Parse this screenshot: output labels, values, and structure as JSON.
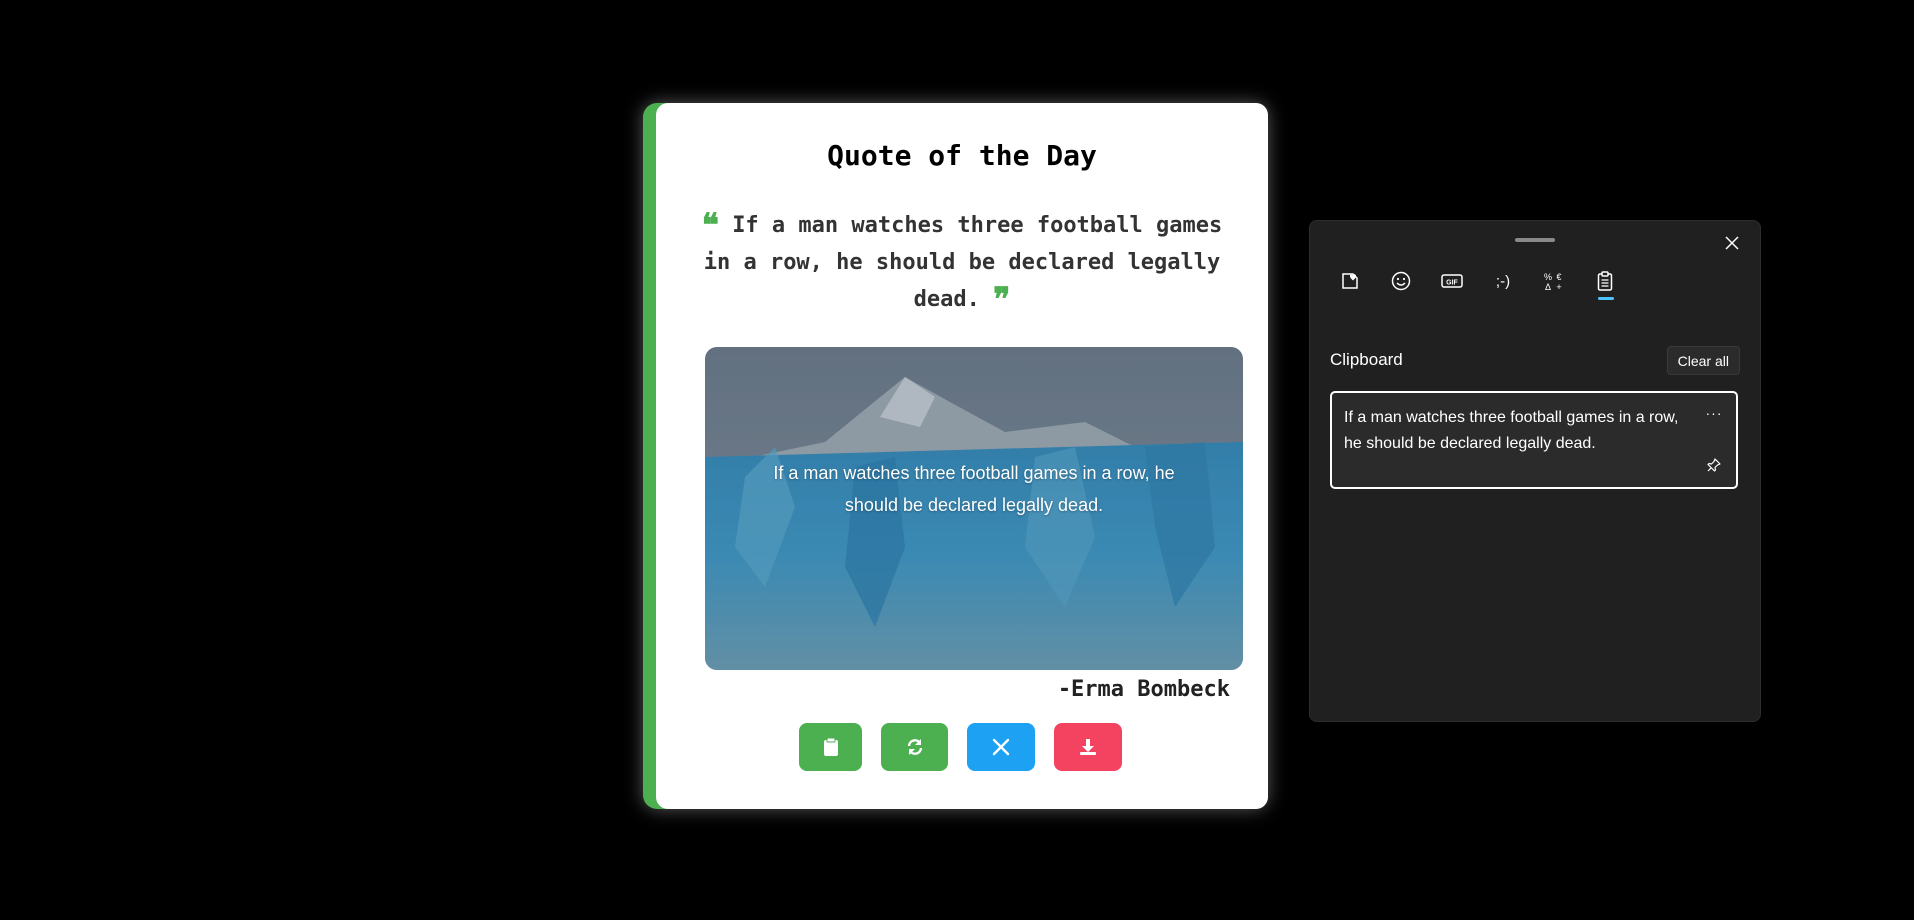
{
  "quote_card": {
    "title": "Quote of the Day",
    "quote_text": "If a man watches three football games in a row, he should be declared legally dead.",
    "open_quote": "❝",
    "close_quote": "❞",
    "image_caption": "If a man watches three football games in a row, he should be declared legally dead.",
    "author": "-Erma Bombeck",
    "buttons": [
      {
        "name": "copy-button",
        "icon": "clipboard-icon",
        "color": "#4caf50"
      },
      {
        "name": "refresh-button",
        "icon": "refresh-icon",
        "color": "#4caf50"
      },
      {
        "name": "share-x-button",
        "icon": "x-logo-icon",
        "color": "#1da1f2"
      },
      {
        "name": "download-button",
        "icon": "download-icon",
        "color": "#f44360"
      }
    ],
    "accent_color": "#4caf50"
  },
  "clipboard_panel": {
    "tabs": [
      {
        "icon": "sticker-heart-icon"
      },
      {
        "icon": "emoji-icon"
      },
      {
        "icon": "gif-icon"
      },
      {
        "icon": "kaomoji-icon",
        "label": ";-)"
      },
      {
        "icon": "symbols-icon"
      },
      {
        "icon": "clipboard-icon",
        "selected": true
      }
    ],
    "section_title": "Clipboard",
    "clear_all_label": "Clear all",
    "items": [
      {
        "text": "If a man watches three football games in a row, he should be declared legally dead.",
        "more_label": "···"
      }
    ],
    "accent_color": "#4cc2ff"
  }
}
